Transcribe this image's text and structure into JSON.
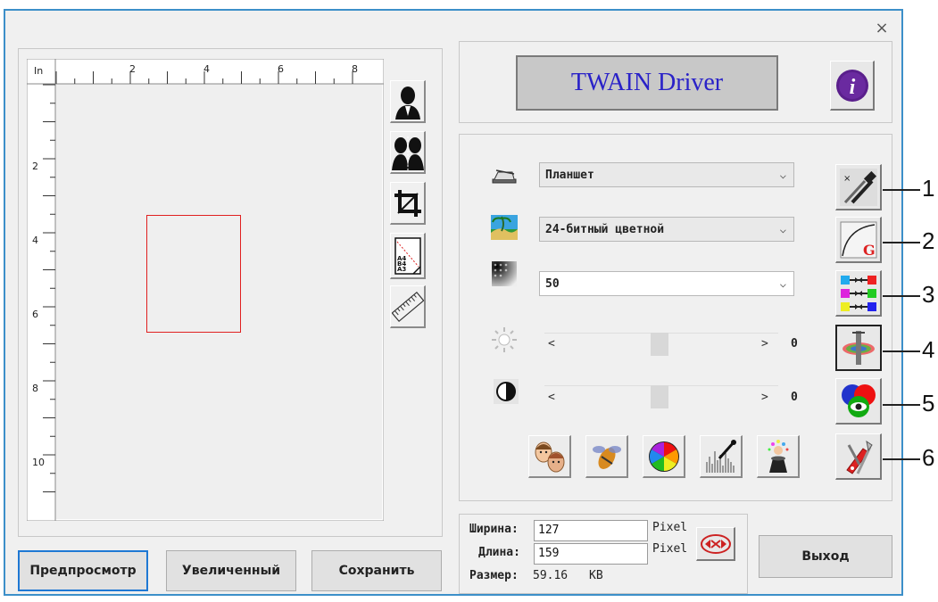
{
  "window": {
    "close_glyph": "×"
  },
  "ruler": {
    "unit": "In",
    "top_labels": [
      "2",
      "4",
      "6",
      "8"
    ],
    "left_labels": [
      "2",
      "4",
      "6",
      "8",
      "10"
    ]
  },
  "preview_tools": [
    {
      "icon": "portrait-icon"
    },
    {
      "icon": "dual-portrait-icon"
    },
    {
      "icon": "crop-icon"
    },
    {
      "icon": "paper-size-icon",
      "sizes": [
        "A4",
        "B4",
        "A3"
      ]
    },
    {
      "icon": "ruler-icon"
    }
  ],
  "header": {
    "title_button": "TWAIN Driver",
    "info_icon": "info-icon"
  },
  "settings": {
    "source": {
      "icon": "scanner-icon",
      "value": "Планшет"
    },
    "mode": {
      "icon": "image-mode-icon",
      "value": "24-битный цветной"
    },
    "resolution": {
      "icon": "halftone-icon",
      "value": "50"
    },
    "brightness": {
      "icon": "brightness-icon",
      "left": "<",
      "right": ">",
      "value": "0",
      "level": 0.5
    },
    "contrast": {
      "icon": "contrast-icon",
      "left": "<",
      "right": ">",
      "value": "0",
      "level": 0.5
    }
  },
  "adjust_tools": [
    {
      "icon": "faces-icon"
    },
    {
      "icon": "descreen-icon"
    },
    {
      "icon": "color-wheel-icon"
    },
    {
      "icon": "histogram-icon"
    },
    {
      "icon": "magic-hat-icon"
    }
  ],
  "side_tools": [
    {
      "icon": "eyedropper-icon",
      "callout": "1"
    },
    {
      "icon": "gamma-curve-icon",
      "callout": "2"
    },
    {
      "icon": "color-balance-icon",
      "callout": "3"
    },
    {
      "icon": "filter-icon",
      "callout": "4"
    },
    {
      "icon": "color-drop-icon",
      "callout": "5"
    },
    {
      "icon": "tools-icon",
      "callout": "6"
    }
  ],
  "image_info": {
    "width_label": "Ширина:",
    "width_value": "127",
    "width_unit": "Pixel",
    "height_label": "Длина:",
    "height_value": "159",
    "height_unit": "Pixel",
    "size_label": "Размер:",
    "size_value": "59.16",
    "size_unit": "KB",
    "lock_icon": "aspect-lock-icon"
  },
  "buttons": {
    "preview": "Предпросмотр",
    "zoom": "Увеличенный",
    "save": "Сохранить",
    "exit": "Выход"
  },
  "colors": {
    "selection_rect": "#e02020",
    "title_text": "#2a22c8",
    "window_border": "#3c8fc9"
  }
}
